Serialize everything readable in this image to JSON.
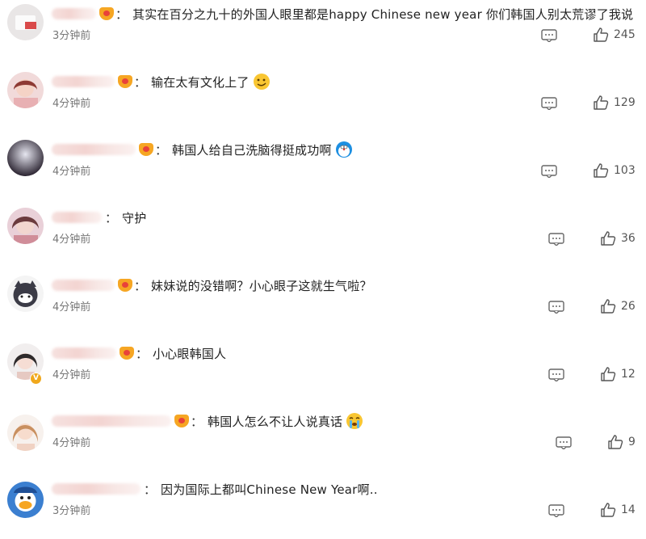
{
  "comments": [
    {
      "text": "其实在百分之九十的外国人眼里都是happy Chinese new year 你们韩国人别太荒谬了我说",
      "time": "3分钟前",
      "likes": "245",
      "has_fan_badge": true,
      "emoji": null,
      "avatar_icon": "avatar-icon",
      "verified": false
    },
    {
      "text": "输在太有文化上了",
      "time": "4分钟前",
      "likes": "129",
      "has_fan_badge": true,
      "emoji": "smirk-face-emoji",
      "avatar_icon": "avatar-icon",
      "verified": false
    },
    {
      "text": "韩国人给自己洗脑得挺成功啊",
      "time": "4分钟前",
      "likes": "103",
      "has_fan_badge": true,
      "emoji": "doraemon-emoji",
      "avatar_icon": "avatar-icon",
      "verified": false
    },
    {
      "text": "守护",
      "time": "4分钟前",
      "likes": "36",
      "has_fan_badge": false,
      "emoji": null,
      "avatar_icon": "avatar-icon",
      "verified": false
    },
    {
      "text": "妹妹说的没错啊？小心眼子这就生气啦？",
      "time": "4分钟前",
      "likes": "26",
      "has_fan_badge": true,
      "emoji": null,
      "avatar_icon": "avatar-icon",
      "verified": false
    },
    {
      "text": "小心眼韩国人",
      "time": "4分钟前",
      "likes": "12",
      "has_fan_badge": true,
      "emoji": null,
      "avatar_icon": "avatar-icon",
      "verified": true
    },
    {
      "text": "韩国人怎么不让人说真话",
      "time": "4分钟前",
      "likes": "9",
      "has_fan_badge": true,
      "emoji": "crying-face-emoji",
      "avatar_icon": "avatar-icon",
      "verified": false
    },
    {
      "text": "因为国际上都叫Chinese New Year啊..",
      "time": "3分钟前",
      "likes": "14",
      "has_fan_badge": false,
      "emoji": null,
      "avatar_icon": "avatar-icon",
      "verified": false
    }
  ],
  "colon": "：",
  "verified_mark": "V",
  "icons": {
    "reply": "comment-reply-icon",
    "like": "thumbs-up-icon"
  },
  "colors": {
    "fan_badge": "#f6a623",
    "time_text": "#777777",
    "count_text": "#555555",
    "blurred_name": "#f3d4d1"
  }
}
